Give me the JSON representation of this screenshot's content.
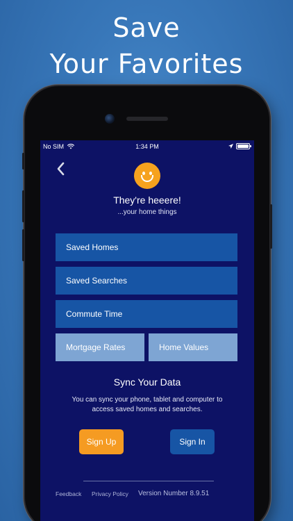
{
  "headline": {
    "line1": "Save",
    "line2": "Your Favorites"
  },
  "statusbar": {
    "carrier": "No SIM",
    "time": "1:34 PM",
    "battery_level": 1.0
  },
  "header": {
    "back_icon": "‹",
    "emoji": "smiley-face-icon",
    "title": "They're heeere!",
    "subtitle": "...your home things"
  },
  "menu": {
    "saved_homes": "Saved Homes",
    "saved_searches": "Saved Searches",
    "commute_time": "Commute Time",
    "mortgage_rates": "Mortgage Rates",
    "home_values": "Home Values"
  },
  "sync": {
    "title": "Sync Your Data",
    "text": "You can sync your phone, tablet and computer to access saved homes and searches.",
    "sign_up": "Sign Up",
    "sign_in": "Sign In"
  },
  "footer": {
    "feedback": "Feedback",
    "privacy": "Privacy Policy",
    "version": "Version Number 8.9.51"
  },
  "colors": {
    "screen_bg": "#0d1265",
    "button_blue": "#1755a5",
    "button_light": "#7ea5d3",
    "accent_orange": "#f59b22"
  }
}
